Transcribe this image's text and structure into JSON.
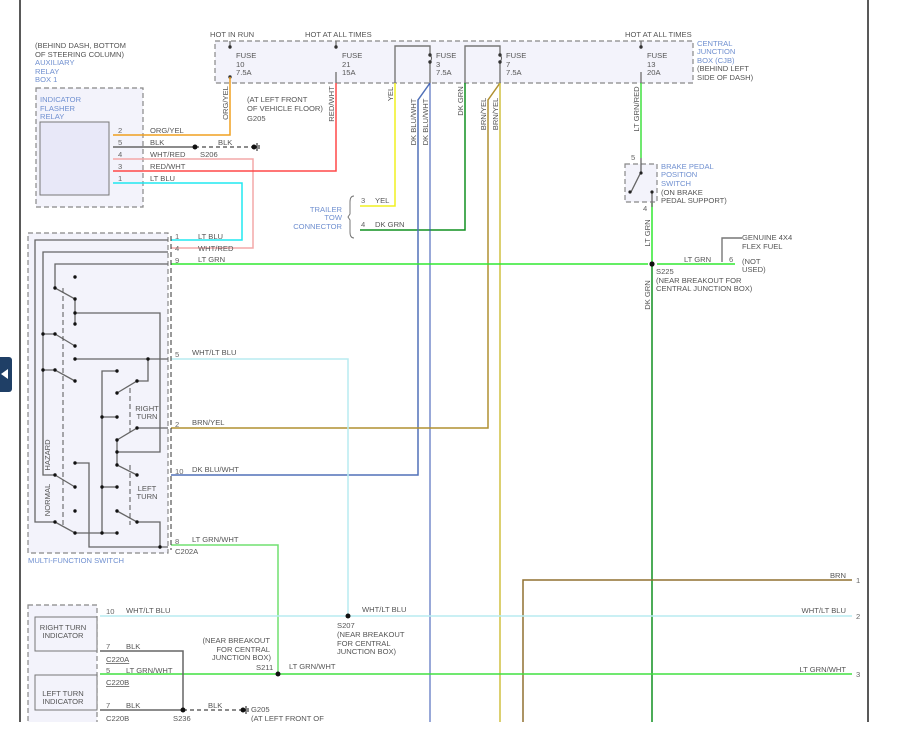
{
  "colors": {
    "org_yel": "#f0a020",
    "blk": "#666666",
    "wht_red": "#f4a8a8",
    "red_wht": "#ff4848",
    "lt_blu": "#20e8f0",
    "yel": "#f0f020",
    "dk_grn": "#109020",
    "lt_grn": "#30e830",
    "dk_blu_wht": "#3050b0",
    "brn_yel": "#c0a040",
    "wht_lt_blu": "#b8ecf0",
    "lt_grn_wht": "#40e040",
    "brn": "#907030",
    "lt_grn_red": "#40e040",
    "blue_label": "#7090d0"
  },
  "cjb": {
    "hot_in_run": "HOT IN RUN",
    "hot_all_1": "HOT AT ALL TIMES",
    "hot_all_2": "HOT AT ALL TIMES",
    "fuses": [
      {
        "name": "FUSE",
        "num": "10",
        "amp": "7.5A"
      },
      {
        "name": "FUSE",
        "num": "21",
        "amp": "15A"
      },
      {
        "name": "FUSE",
        "num": "3",
        "amp": "7.5A"
      },
      {
        "name": "FUSE",
        "num": "7",
        "amp": "7.5A"
      },
      {
        "name": "FUSE",
        "num": "13",
        "amp": "20A"
      }
    ],
    "label": [
      "CENTRAL",
      "JUNCTION",
      "BOX (CJB)"
    ],
    "location": [
      "(BEHIND LEFT",
      "SIDE OF DASH)"
    ]
  },
  "relay": {
    "location": [
      "(BEHIND DASH, BOTTOM",
      "OF STEERING COLUMN)"
    ],
    "box": [
      "AUXILIARY",
      "RELAY",
      "BOX 1"
    ],
    "name": [
      "INDICATOR",
      "FLASHER",
      "RELAY"
    ],
    "pins": [
      {
        "pin": "2",
        "wire": "ORG/YEL"
      },
      {
        "pin": "5",
        "wire": "BLK"
      },
      {
        "pin": "4",
        "wire": "WHT/RED"
      },
      {
        "pin": "3",
        "wire": "RED/WHT"
      },
      {
        "pin": "1",
        "wire": "LT BLU"
      }
    ]
  },
  "ground_top": {
    "splice": "S206",
    "wire": "BLK",
    "ground": "G205",
    "location": [
      "(AT LEFT FRONT",
      "OF VEHICLE FLOOR)"
    ]
  },
  "vertical_wires": {
    "org_yel": "ORG/YEL",
    "red_wht": "RED/WHT",
    "yel": "YEL",
    "dk_blu_wht_1": "DK BLU/WHT",
    "dk_blu_wht_2": "DK BLU/WHT",
    "dk_grn": "DK GRN",
    "brn_yel_1": "BRN/YEL",
    "brn_yel_2": "BRN/YEL",
    "lt_grn_red": "LT GRN/RED",
    "lt_grn": "LT GRN",
    "dk_grn_2": "DK GRN"
  },
  "trailer": {
    "label": [
      "TRAILER",
      "TOW",
      "CONNECTOR"
    ],
    "pins": [
      {
        "pin": "3",
        "wire": "YEL"
      },
      {
        "pin": "4",
        "wire": "DK GRN"
      }
    ]
  },
  "brake": {
    "pin_top": "5",
    "pin_bottom": "4",
    "label": [
      "BRAKE PEDAL",
      "POSITION",
      "SWITCH"
    ],
    "location": [
      "(ON BRAKE",
      "PEDAL SUPPORT)"
    ]
  },
  "s225": {
    "wire": "LT GRN",
    "pin": "6",
    "splice": "S225",
    "location": [
      "(NEAR BREAKOUT FOR",
      "CENTRAL JUNCTION BOX)"
    ],
    "option": [
      "GENUINE 4X4",
      "FLEX FUEL"
    ],
    "not_used": [
      "(NOT",
      "USED)"
    ]
  },
  "mfs": {
    "name": "MULTI-FUNCTION SWITCH",
    "connector": "C202A",
    "hazard": "HAZARD",
    "normal": "NORMAL",
    "right_turn": [
      "RIGHT",
      "TURN"
    ],
    "left_turn": [
      "LEFT",
      "TURN"
    ],
    "pins": [
      {
        "pin": "1",
        "wire": "LT BLU"
      },
      {
        "pin": "4",
        "wire": "WHT/RED"
      },
      {
        "pin": "9",
        "wire": "LT GRN"
      },
      {
        "pin": "5",
        "wire": "WHT/LT BLU"
      },
      {
        "pin": "2",
        "wire": "BRN/YEL"
      },
      {
        "pin": "10",
        "wire": "DK BLU/WHT"
      },
      {
        "pin": "8",
        "wire": "LT GRN/WHT"
      }
    ]
  },
  "bottom": {
    "right_indicator": [
      "RIGHT TURN",
      "INDICATOR"
    ],
    "left_indicator": [
      "LEFT TURN",
      "INDICATOR"
    ],
    "pins": [
      {
        "pin": "10",
        "wire": "WHT/LT BLU"
      },
      {
        "pin": "7",
        "wire": "BLK",
        "conn": "C220A"
      },
      {
        "pin": "5",
        "wire": "LT GRN/WHT",
        "conn": "C220B"
      },
      {
        "pin": "7",
        "wire": "BLK",
        "conn": "C220B"
      }
    ],
    "s207": {
      "wire": "WHT/LT BLU",
      "splice": "S207",
      "location": [
        "(NEAR BREAKOUT",
        "FOR CENTRAL",
        "JUNCTION BOX)"
      ]
    },
    "s211": {
      "wire": "LT GRN/WHT",
      "splice": "S211",
      "location": [
        "(NEAR BREAKOUT",
        "FOR CENTRAL",
        "JUNCTION BOX)"
      ]
    },
    "s236": "S236",
    "ground": {
      "wire": "BLK",
      "ground": "G205",
      "location": "(AT LEFT FRONT OF"
    },
    "right_pins": [
      {
        "pin": "1",
        "wire": "BRN"
      },
      {
        "pin": "2",
        "wire": "WHT/LT BLU"
      },
      {
        "pin": "3",
        "wire": "LT GRN/WHT"
      }
    ]
  },
  "nav": {
    "prev": "previous-page"
  }
}
